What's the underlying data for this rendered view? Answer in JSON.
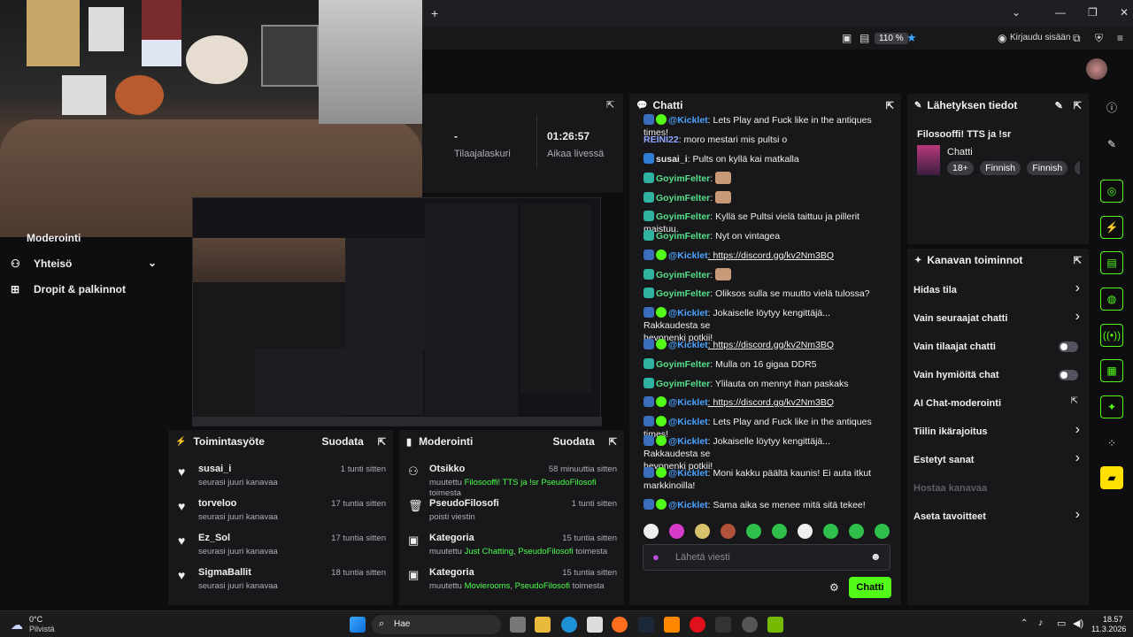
{
  "browser": {
    "new_tab_icon": "plus-icon",
    "zoom": "110 %",
    "login_label": "Kirjaudu sisään"
  },
  "stats": {
    "subs_value": "-",
    "subs_label": "Tilaajalaskuri",
    "live_value": "01:26:57",
    "live_label": "Aikaa livessä"
  },
  "left_nav": {
    "items": [
      {
        "label": "Moderointi",
        "icon": "shield-icon"
      },
      {
        "label": "Yhteisö",
        "icon": "people-icon"
      },
      {
        "label": "Dropit & palkinnot",
        "icon": "gift-icon"
      }
    ]
  },
  "activity": {
    "title": "Toimintasyöte",
    "filter": "Suodata",
    "items": [
      {
        "user": "susai_i",
        "text": "seurasi juuri kanavaa",
        "time": "1 tunti sitten"
      },
      {
        "user": "torveloo",
        "text": "seurasi juuri kanavaa",
        "time": "17 tuntia sitten"
      },
      {
        "user": "Ez_Sol",
        "text": "seurasi juuri kanavaa",
        "time": "17 tuntia sitten"
      },
      {
        "user": "SigmaBallit",
        "text": "seurasi juuri kanavaa",
        "time": "18 tuntia sitten"
      }
    ]
  },
  "moderation": {
    "title": "Moderointi",
    "filter": "Suodata",
    "items": [
      {
        "head": "Otsikko",
        "time": "58 minuuttia sitten",
        "line1_a": "muutettu ",
        "line1_b": "Filosooffi! TTS ja !sr",
        "line1_c": " ",
        "line1_d": "PseudoFilosofi",
        "line2": "toimesta"
      },
      {
        "head": "PseudoFilosofi",
        "time": "1 tunti sitten",
        "line1_a": "poisti viestin",
        "line1_b": "",
        "line1_c": "",
        "line1_d": "",
        "line2": ""
      },
      {
        "head": "Kategoria",
        "time": "15 tuntia sitten",
        "line1_a": "muutettu ",
        "line1_b": "Just Chatting",
        "line1_c": ", ",
        "line1_d": "PseudoFilosofi",
        "line2": " toimesta"
      },
      {
        "head": "Kategoria",
        "time": "15 tuntia sitten",
        "line1_a": "muutettu ",
        "line1_b": "Movierooms",
        "line1_c": ", ",
        "line1_d": "PseudoFilosofi",
        "line2": " toimesta"
      }
    ]
  },
  "chat": {
    "title": "Chatti",
    "messages": [
      {
        "user": "@Kicklet",
        "user_color": "#4aa3ff",
        "text": ": Lets Play and Fuck like in the antiques times!",
        "badge": "bot"
      },
      {
        "user": "REINI22",
        "user_color": "#8fa8ff",
        "text": ": moro mestari mis pultsi o",
        "badge": ""
      },
      {
        "user": "susai_i",
        "user_color": "#e8e8e8",
        "text": ": Pults on kyllä kai matkalla",
        "badge": "arrow"
      },
      {
        "user": "GoyimFelter",
        "user_color": "#56e08a",
        "text": ":",
        "badge": "sub"
      },
      {
        "user": "GoyimFelter",
        "user_color": "#56e08a",
        "text": ":",
        "badge": "sub"
      },
      {
        "user": "GoyimFelter",
        "user_color": "#56e08a",
        "text": ": Kyllä se Pultsi vielä taittuu ja pillerit maistuu.",
        "badge": "sub"
      },
      {
        "user": "GoyimFelter",
        "user_color": "#56e08a",
        "text": ": Nyt on vintagea",
        "badge": "sub"
      },
      {
        "user": "@Kicklet",
        "user_color": "#4aa3ff",
        "text": ": https://discord.gg/kv2Nm3BQ",
        "badge": "bot"
      },
      {
        "user": "GoyimFelter",
        "user_color": "#56e08a",
        "text": ":",
        "badge": "sub"
      },
      {
        "user": "GoyimFelter",
        "user_color": "#56e08a",
        "text": ": Oliksos sulla se muutto vielä tulossa?",
        "badge": "sub"
      },
      {
        "user": "@Kicklet",
        "user_color": "#4aa3ff",
        "text": ": Jokaiselle löytyy kengittäjä... Rakkaudesta se",
        "badge": "bot",
        "cont": "hevonenki potkii!"
      },
      {
        "user": "@Kicklet",
        "user_color": "#4aa3ff",
        "text": ": https://discord.gg/kv2Nm3BQ",
        "badge": "bot"
      },
      {
        "user": "GoyimFelter",
        "user_color": "#56e08a",
        "text": ": Mulla on 16 gigaa DDR5",
        "badge": "sub"
      },
      {
        "user": "GoyimFelter",
        "user_color": "#56e08a",
        "text": ": Ylilauta on mennyt ihan paskaks",
        "badge": "sub"
      },
      {
        "user": "@Kicklet",
        "user_color": "#4aa3ff",
        "text": ": https://discord.gg/kv2Nm3BQ",
        "badge": "bot"
      },
      {
        "user": "@Kicklet",
        "user_color": "#4aa3ff",
        "text": ": Lets Play and Fuck like in the antiques times!",
        "badge": "bot"
      },
      {
        "user": "@Kicklet",
        "user_color": "#4aa3ff",
        "text": ": Jokaiselle löytyy kengittäjä... Rakkaudesta se",
        "badge": "bot",
        "cont": "hevonenki potkii!"
      },
      {
        "user": "@Kicklet",
        "user_color": "#4aa3ff",
        "text": ": Moni kakku päältä kaunis! Ei auta itkut",
        "badge": "bot",
        "cont": "markkinoilla!"
      },
      {
        "user": "@Kicklet",
        "user_color": "#4aa3ff",
        "text": ": Sama aika se menee mitä sitä tekee!",
        "badge": "bot"
      }
    ],
    "input_placeholder": "Lähetä viesti",
    "send_label": "Chatti"
  },
  "stream_info": {
    "title": "Lähetyksen tiedot",
    "stream_title": "Filosooffi! TTS ja !sr",
    "category": "Chatti",
    "tags": [
      "18+",
      "Finnish",
      "Finnish",
      "K"
    ]
  },
  "channel_actions": {
    "title": "Kanavan toiminnot",
    "items": [
      {
        "label": "Hidas tila",
        "control": "chevron"
      },
      {
        "label": "Vain seuraajat chatti",
        "control": "chevron"
      },
      {
        "label": "Vain tilaajat chatti",
        "control": "toggle"
      },
      {
        "label": "Vain hymiöitä chat",
        "control": "toggle"
      },
      {
        "label": "AI Chat-moderointi",
        "control": "external"
      },
      {
        "label": "Tiilin ikärajoitus",
        "control": "chevron"
      },
      {
        "label": "Estetyt sanat",
        "control": "chevron"
      },
      {
        "label": "Hostaa kanavaa",
        "control": "none"
      },
      {
        "label": "Aseta tavoitteet",
        "control": "chevron"
      }
    ]
  },
  "taskbar": {
    "temp": "0°C",
    "weather": "Pilvistä",
    "search": "Hae",
    "time": "18.57",
    "date": "11.3.2026"
  },
  "colors": {
    "accent_green": "#53fc18",
    "bg": "#0e0e10",
    "panel": "#18181b"
  }
}
